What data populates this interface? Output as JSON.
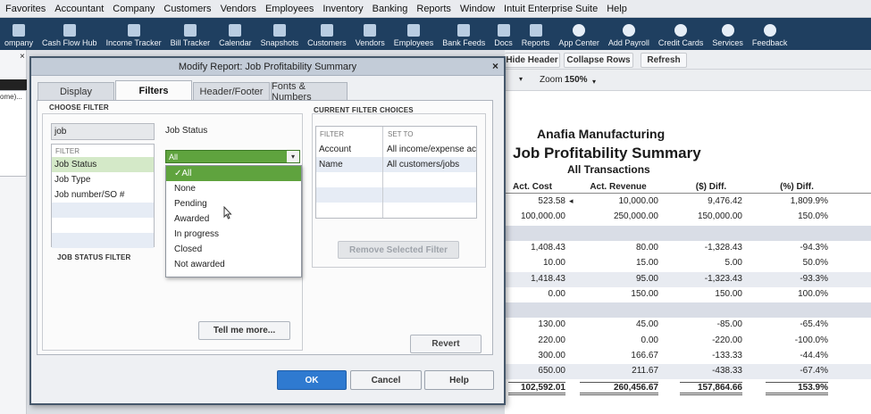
{
  "menu": [
    "Favorites",
    "Accountant",
    "Company",
    "Customers",
    "Vendors",
    "Employees",
    "Inventory",
    "Banking",
    "Reports",
    "Window",
    "Intuit Enterprise Suite",
    "Help"
  ],
  "toolbar": [
    {
      "label": "ompany",
      "icon": "company-icon"
    },
    {
      "label": "Cash Flow Hub",
      "icon": "cash-flow-icon"
    },
    {
      "label": "Income Tracker",
      "icon": "income-tracker-icon"
    },
    {
      "label": "Bill Tracker",
      "icon": "bill-tracker-icon"
    },
    {
      "label": "Calendar",
      "icon": "calendar-icon"
    },
    {
      "label": "Snapshots",
      "icon": "snapshots-icon"
    },
    {
      "label": "Customers",
      "icon": "customers-icon"
    },
    {
      "label": "Vendors",
      "icon": "vendors-icon"
    },
    {
      "label": "Employees",
      "icon": "employees-icon"
    },
    {
      "label": "Bank Feeds",
      "icon": "bank-feeds-icon"
    },
    {
      "label": "Docs",
      "icon": "docs-icon"
    },
    {
      "label": "Reports",
      "icon": "reports-icon"
    },
    {
      "label": "App Center",
      "icon": "app-center-icon"
    },
    {
      "label": "Add Payroll",
      "icon": "add-payroll-icon"
    },
    {
      "label": "Credit Cards",
      "icon": "credit-cards-icon"
    },
    {
      "label": "Services",
      "icon": "services-icon"
    },
    {
      "label": "Feedback",
      "icon": "feedback-icon"
    }
  ],
  "left_stub": {
    "close": "×",
    "text": "ome)..."
  },
  "report": {
    "buttons": {
      "hide_header": "Hide Header",
      "collapse_rows": "Collapse Rows",
      "refresh": "Refresh"
    },
    "zoom_label": "Zoom",
    "zoom_value": "150%",
    "company": "Anafia Manufacturing",
    "title": "Job Profitability Summary",
    "subtitle": "All Transactions",
    "columns": [
      "Act. Cost",
      "Act. Revenue",
      "($) Diff.",
      "(%) Diff."
    ],
    "rows": [
      {
        "kind": "data",
        "cells": [
          "523.58",
          "10,000.00",
          "9,476.42",
          "1,809.9%"
        ],
        "marker": "◂"
      },
      {
        "kind": "data",
        "cells": [
          "100,000.00",
          "250,000.00",
          "150,000.00",
          "150.0%"
        ]
      },
      {
        "kind": "band",
        "cells": [
          "",
          "",
          "",
          ""
        ]
      },
      {
        "kind": "data",
        "cells": [
          "1,408.43",
          "80.00",
          "-1,328.43",
          "-94.3%"
        ]
      },
      {
        "kind": "data",
        "cells": [
          "10.00",
          "15.00",
          "5.00",
          "50.0%"
        ]
      },
      {
        "kind": "alt",
        "cells": [
          "1,418.43",
          "95.00",
          "-1,323.43",
          "-93.3%"
        ]
      },
      {
        "kind": "data",
        "cells": [
          "0.00",
          "150.00",
          "150.00",
          "100.0%"
        ]
      },
      {
        "kind": "band",
        "cells": [
          "",
          "",
          "",
          ""
        ]
      },
      {
        "kind": "data",
        "cells": [
          "130.00",
          "45.00",
          "-85.00",
          "-65.4%"
        ]
      },
      {
        "kind": "data",
        "cells": [
          "220.00",
          "0.00",
          "-220.00",
          "-100.0%"
        ]
      },
      {
        "kind": "data",
        "cells": [
          "300.00",
          "166.67",
          "-133.33",
          "-44.4%"
        ]
      },
      {
        "kind": "alt",
        "cells": [
          "650.00",
          "211.67",
          "-438.33",
          "-67.4%"
        ]
      },
      {
        "kind": "total",
        "cells": [
          "102,592.01",
          "260,456.67",
          "157,864.66",
          "153.9%"
        ]
      }
    ]
  },
  "dialog": {
    "title": "Modify Report: Job Profitability Summary",
    "close": "×",
    "tabs": [
      "Display",
      "Filters",
      "Header/Footer",
      "Fonts & Numbers"
    ],
    "active_tab": "Filters",
    "choose_filter_label": "CHOOSE FILTER",
    "search_value": "job",
    "filter_list_head": "FILTER",
    "filters": [
      "Job Status",
      "Job Type",
      "Job number/SO #"
    ],
    "job_status_label": "Job Status",
    "select_value": "All",
    "dropdown_arrow": "▾",
    "options": [
      "All",
      "None",
      "Pending",
      "Awarded",
      "In progress",
      "Closed",
      "Not awarded"
    ],
    "job_status_filter_label": "JOB STATUS FILTER",
    "tell_me_more": "Tell me more...",
    "current_choices_label": "CURRENT FILTER CHOICES",
    "current_head_filter": "FILTER",
    "current_head_set": "SET TO",
    "current_rows": [
      {
        "filter": "Account",
        "set": "All income/expense ac..."
      },
      {
        "filter": "Name",
        "set": "All customers/jobs"
      }
    ],
    "remove_filter": "Remove Selected Filter",
    "revert": "Revert",
    "ok": "OK",
    "cancel": "Cancel",
    "help": "Help"
  }
}
